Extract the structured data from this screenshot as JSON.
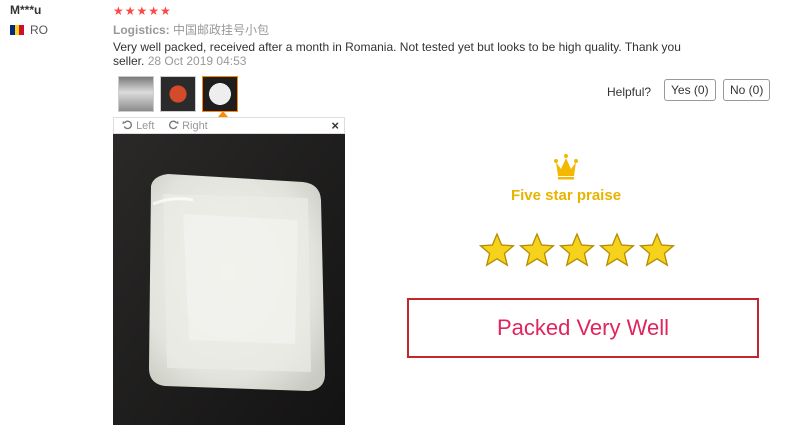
{
  "reviewer": {
    "name": "M***u",
    "country_code": "RO",
    "flag_colors": [
      "#002b7f",
      "#fcd116",
      "#ce1126"
    ]
  },
  "review": {
    "rating_stars": "★★★★★",
    "rating": 5,
    "logistics_label": "Logistics:",
    "logistics_value": "中国邮政挂号小包",
    "text": "Very well packed, received after a month in Romania. Not tested yet but looks to be high quality. Thank you seller.",
    "date": "28 Oct 2019 04:53"
  },
  "helpful": {
    "label": "Helpful?",
    "yes": "Yes (0)",
    "no": "No (0)"
  },
  "viewer": {
    "rotate_left": "Left",
    "rotate_right": "Right",
    "close": "×"
  },
  "promo": {
    "heading": "Five star praise",
    "packed_text": "Packed Very Well",
    "gold": "#f5b800",
    "red_border": "#c1272d"
  }
}
